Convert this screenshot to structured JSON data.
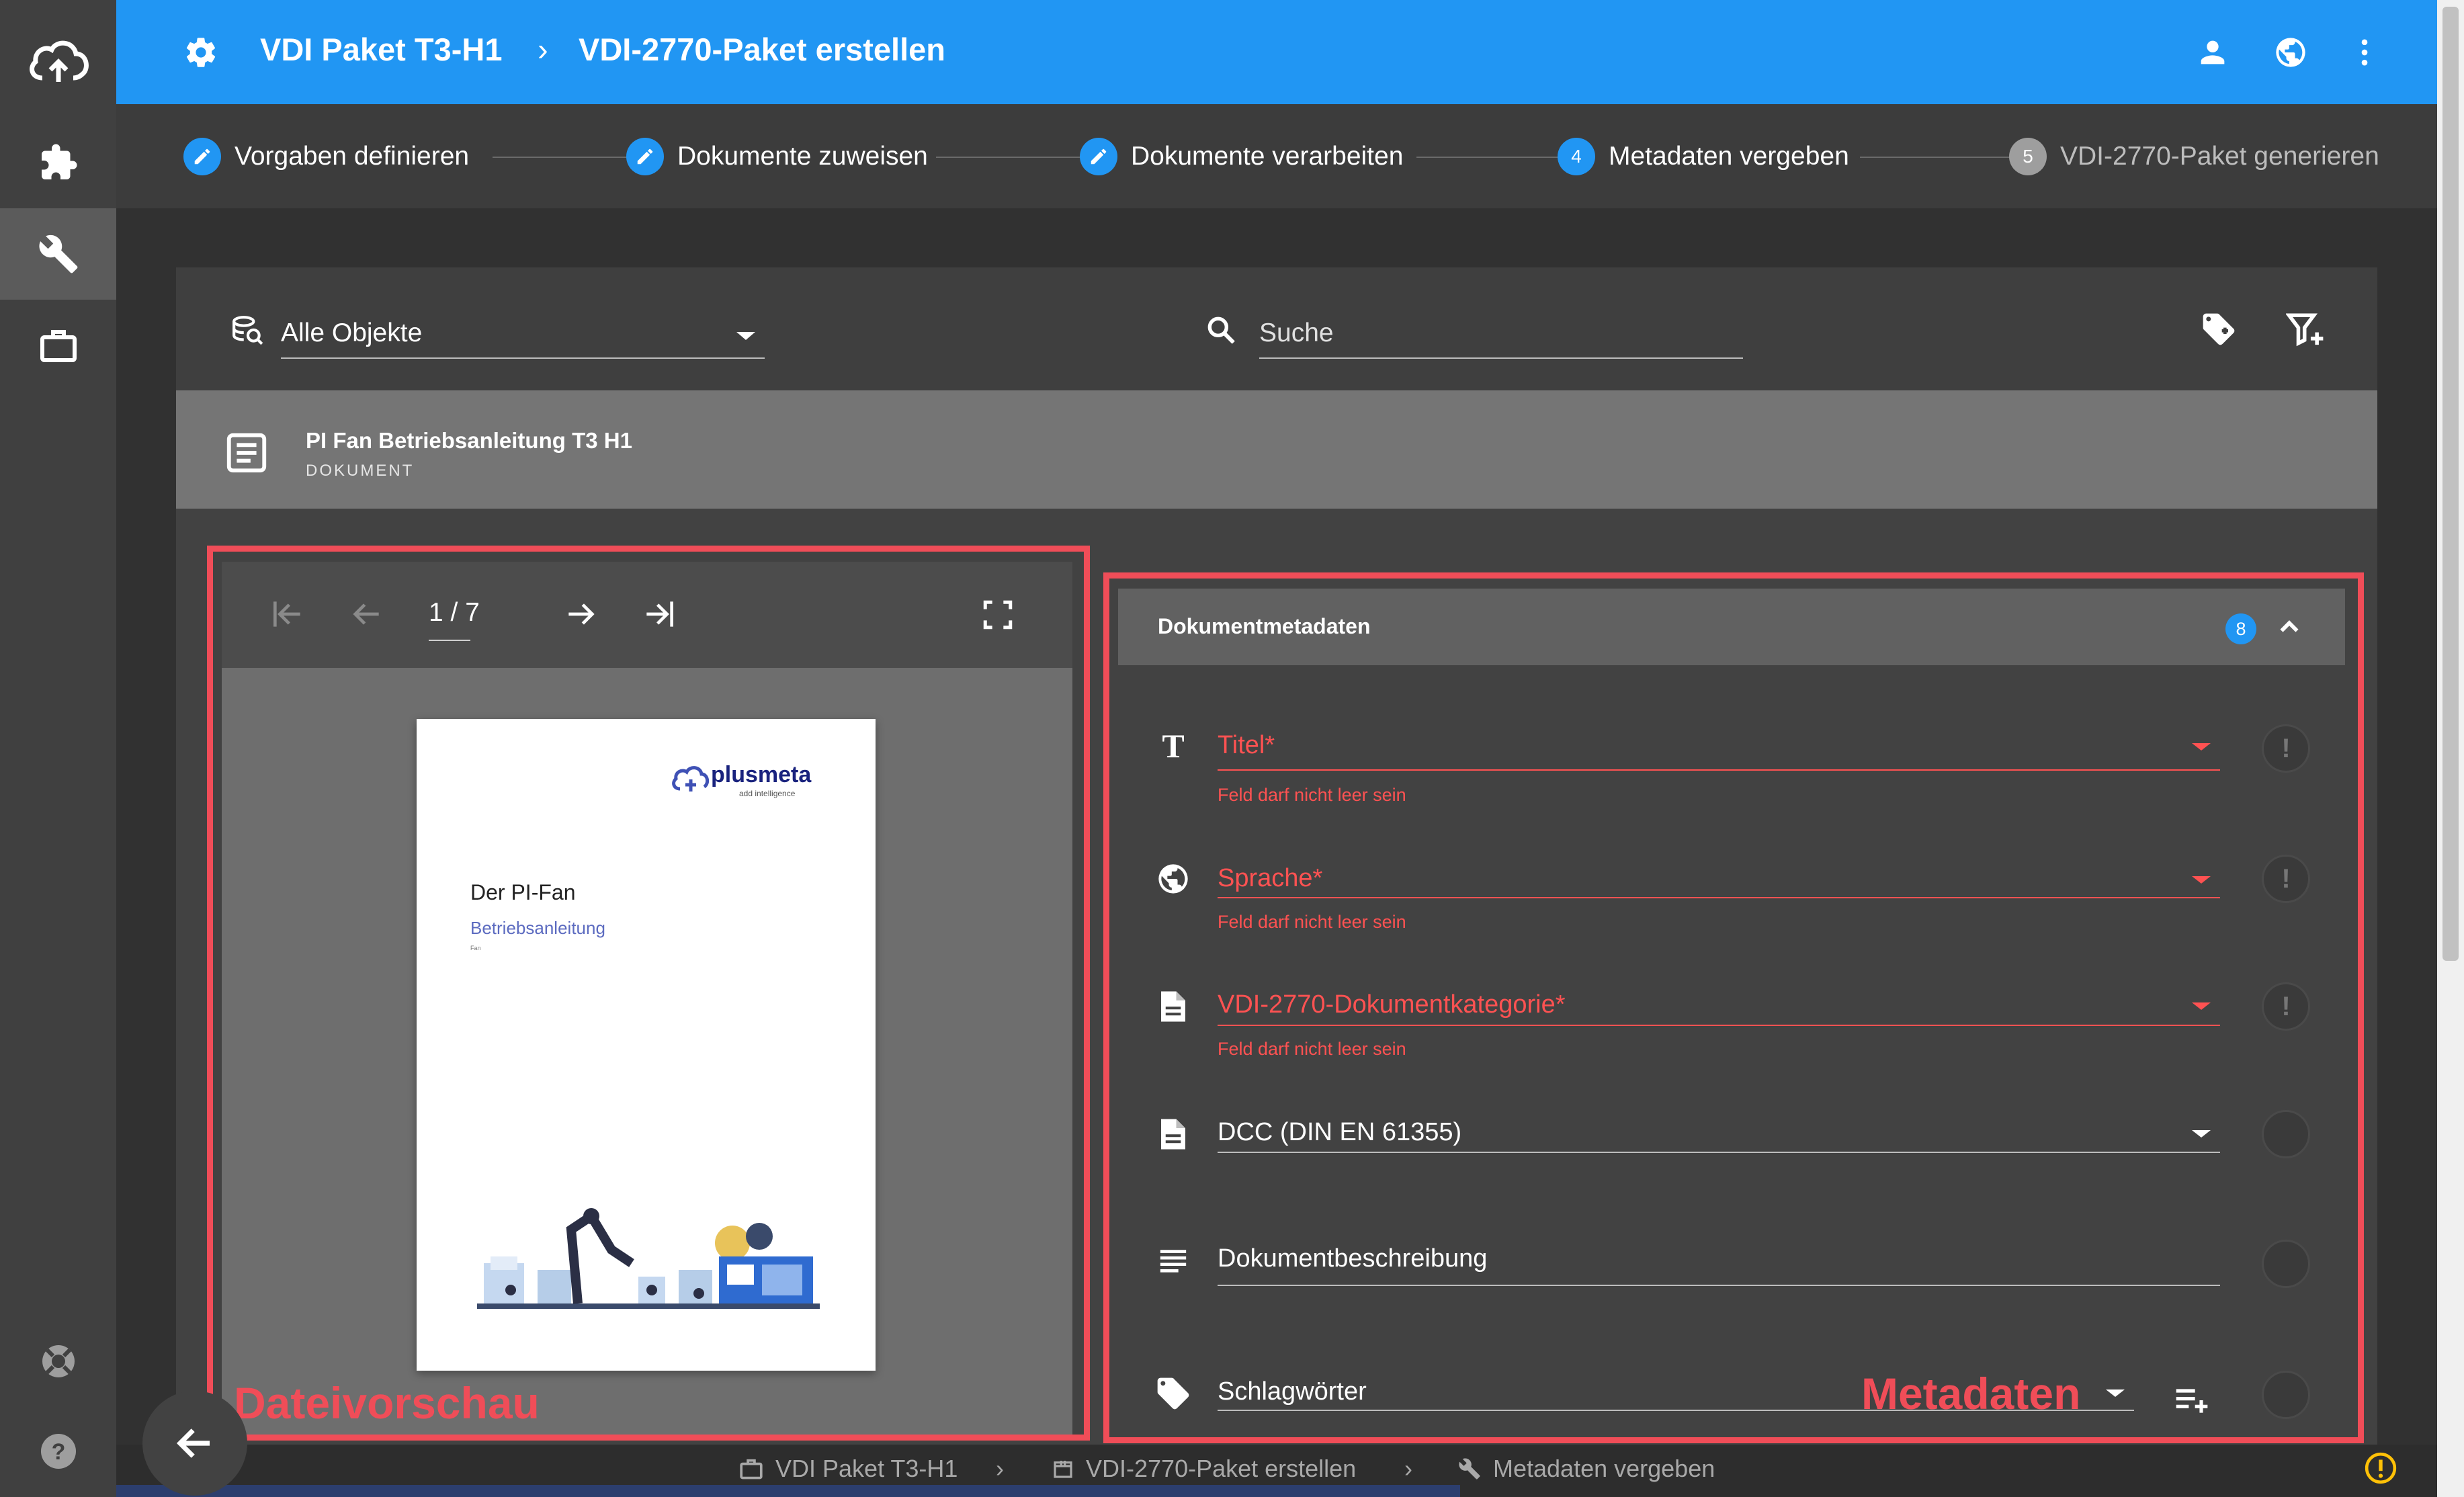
{
  "header": {
    "project": "VDI Paket T3-H1",
    "separator": "›",
    "page": "VDI-2770-Paket erstellen"
  },
  "stepper": {
    "steps": [
      {
        "label": "Vorgaben definieren",
        "marker": "edit"
      },
      {
        "label": "Dokumente zuweisen",
        "marker": "edit"
      },
      {
        "label": "Dokumente verarbeiten",
        "marker": "edit"
      },
      {
        "label": "Metadaten vergeben",
        "marker": "4"
      },
      {
        "label": "VDI-2770-Paket generieren",
        "marker": "5"
      }
    ]
  },
  "filter": {
    "scope": "Alle Objekte",
    "search_placeholder": "Suche"
  },
  "document": {
    "title": "PI Fan Betriebsanleitung T3 H1",
    "type": "DOKUMENT"
  },
  "viewer": {
    "page_indicator": "1 / 7",
    "preview": {
      "brand": "plusmeta",
      "brand_tagline": "add intelligence",
      "doc_title": "Der PI-Fan",
      "doc_subtitle": "Betriebsanleitung",
      "doc_small": "Fan"
    }
  },
  "metadata": {
    "header": "Dokumentmetadaten",
    "count": "8",
    "fields": [
      {
        "label": "Titel*",
        "error": "Feld darf nicht leer sein"
      },
      {
        "label": "Sprache*",
        "error": "Feld darf nicht leer sein"
      },
      {
        "label": "VDI-2770-Dokumentkategorie*",
        "error": "Feld darf nicht leer sein"
      },
      {
        "label": "DCC (DIN EN 61355)"
      },
      {
        "label": "Dokumentbeschreibung"
      },
      {
        "label": "Schlagwörter"
      }
    ]
  },
  "annotations": {
    "left": "Dateivorschau",
    "right": "Metadaten"
  },
  "statusbar": {
    "items": [
      "VDI Paket T3-H1",
      "VDI-2770-Paket erstellen",
      "Metadaten vergeben"
    ]
  },
  "colors": {
    "primary": "#2196f3",
    "error": "#ff5252",
    "annotation": "#f04d58",
    "warning": "#ffc107"
  },
  "icons": {
    "nav": [
      "cloud-upload-icon",
      "puzzle-icon",
      "wrench-icon",
      "briefcase-icon",
      "lifebuoy-icon",
      "help-icon"
    ]
  }
}
